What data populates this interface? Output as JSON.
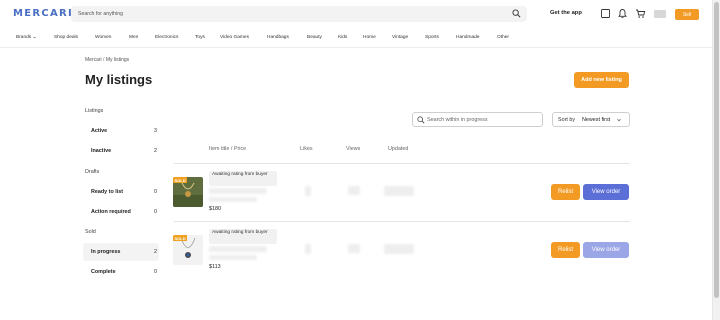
{
  "header": {
    "logo": "MERCARI",
    "search_placeholder": "Search for anything",
    "get_app": "Get the app",
    "sell": "Sell"
  },
  "categories": [
    "Brands ⌄",
    "Shop deals",
    "Women",
    "Men",
    "Electronics",
    "Toys",
    "Video Games",
    "Handbags",
    "Beauty",
    "Kids",
    "Home",
    "Vintage",
    "Sports",
    "Handmade",
    "Other"
  ],
  "breadcrumb": {
    "root": "Mercari",
    "separator": " / ",
    "current": "My listings"
  },
  "page_title": "My listings",
  "add_listing": "Add new listing",
  "sidebar": {
    "listings_heading": "Listings",
    "active": {
      "label": "Active",
      "count": "3"
    },
    "inactive": {
      "label": "Inactive",
      "count": "2"
    },
    "drafts_heading": "Drafts",
    "ready": {
      "label": "Ready to list",
      "count": "0"
    },
    "action": {
      "label": "Action required",
      "count": "0"
    },
    "sold_heading": "Sold",
    "in_progress": {
      "label": "In progress",
      "count": "2"
    },
    "complete": {
      "label": "Complete",
      "count": "0"
    }
  },
  "table": {
    "search_placeholder": "Search within in progress",
    "sort_label": "Sort by",
    "sort_value": "Newest first",
    "columns": {
      "title": "Item title / Price",
      "likes": "Likes",
      "views": "Views",
      "updated": "Updated"
    },
    "rows": [
      {
        "sold_tag": "SOLD",
        "status": "Awaiting rating from buyer",
        "price": "$180",
        "relist": "Relist",
        "view_order": "View order"
      },
      {
        "sold_tag": "SOLD",
        "status": "Awaiting rating from buyer",
        "price": "$113",
        "relist": "Relist",
        "view_order": "View order"
      }
    ]
  },
  "colors": {
    "brand": "#4b6fc4",
    "accent_orange": "#f39a24",
    "button_blue": "#5b6fd6"
  },
  "icons": [
    "search-icon",
    "notes-icon",
    "bell-icon",
    "cart-icon",
    "chevron-down-icon"
  ]
}
